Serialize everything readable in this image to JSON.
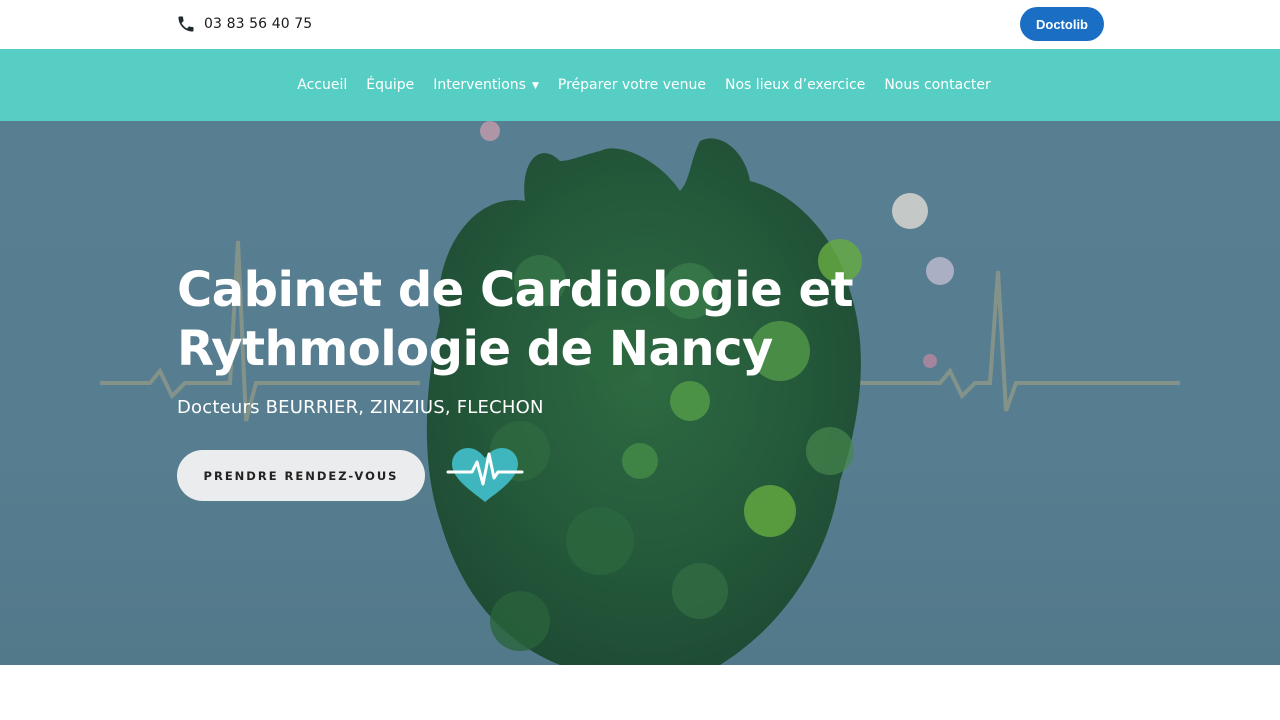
{
  "topbar": {
    "phone_icon": "phone-icon",
    "phone_number": "03 83 56 40 75",
    "doctolib_label": "Doctolib"
  },
  "nav": {
    "items": [
      {
        "label": "Accueil"
      },
      {
        "label": "Équipe"
      },
      {
        "label": "Interventions",
        "has_dropdown": true
      },
      {
        "label": "Préparer votre venue"
      },
      {
        "label": "Nos lieux d’exercice"
      },
      {
        "label": "Nous contacter"
      }
    ],
    "dropdown_icon": "chevron-down-icon"
  },
  "hero": {
    "title_line1": "Cabinet de Cardiologie et",
    "title_line2": "Rythmologie de Nancy",
    "subtitle": "Docteurs BEURRIER, ZINZIUS, FLECHON",
    "cta_label": "PRENDRE RENDEZ-VOUS",
    "heart_icon": "heartbeat-icon",
    "background_image": "moss-heart-illustration"
  },
  "colors": {
    "nav_bg": "#57cec4",
    "doctolib_bg": "#1a6fc5",
    "hero_bg": "#5d8497",
    "heart_accent": "#3fb6bd"
  }
}
